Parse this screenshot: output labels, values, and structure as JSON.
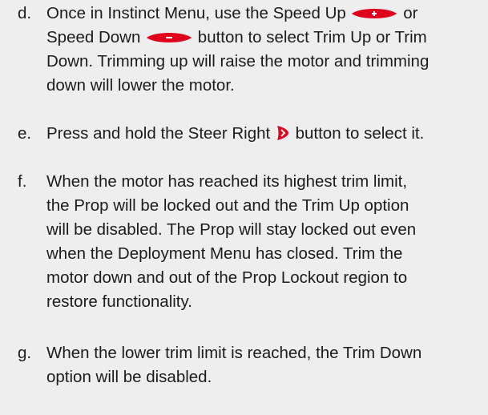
{
  "items": [
    {
      "letter": "d.",
      "line1_a": "Once in Instinct Menu, use the Speed Up",
      "line1_b": "or",
      "line2_a": "Speed Down",
      "line2_b": "button to select Trim Up or Trim",
      "line3": "Down. Trimming up will raise the motor and trimming",
      "line4": "down will lower the motor.",
      "icons": [
        "speed-up-icon",
        "speed-down-icon"
      ]
    },
    {
      "letter": "e.",
      "line1_a": "Press and hold the Steer Right",
      "line1_b": "button to select it.",
      "icons": [
        "steer-right-icon"
      ]
    },
    {
      "letter": "f.",
      "lines": [
        "When the motor has reached its highest trim limit,",
        "the Prop will be locked out and the Trim Up option",
        "will be disabled. The Prop will stay locked out even",
        "when the Deployment Menu has closed. Trim the",
        "motor down and out of the Prop Lockout region to",
        "restore functionality."
      ]
    },
    {
      "letter": "g.",
      "lines": [
        "When the lower trim limit is reached, the Trim Down",
        "option will be disabled."
      ]
    }
  ],
  "colors": {
    "background": "#eeeeee",
    "text": "#1c1c1c",
    "button_red": "#e0001b"
  }
}
